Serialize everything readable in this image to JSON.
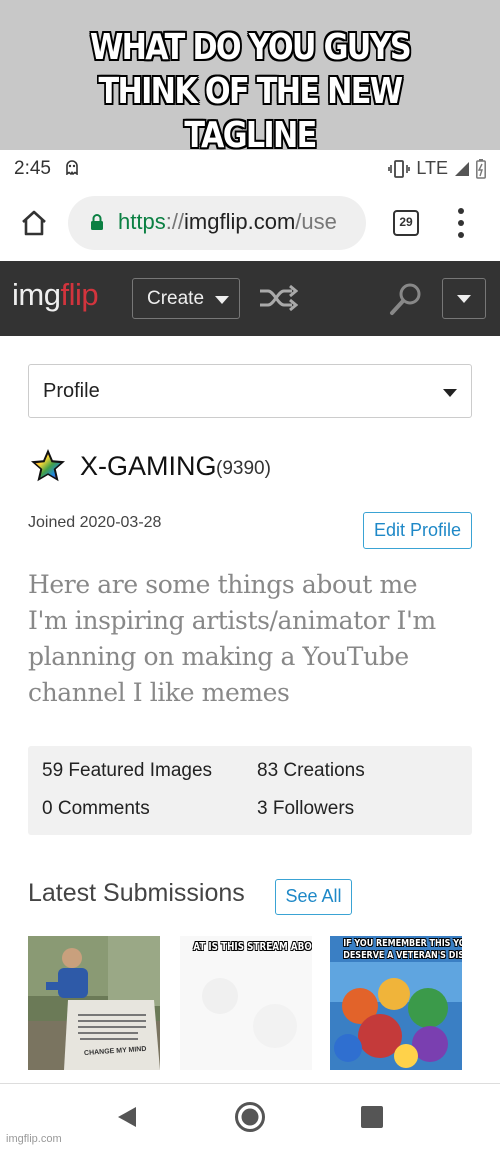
{
  "meme": {
    "caption_line1": "WHAT DO YOU GUYS",
    "caption_line2": "THINK OF THE NEW TAGLINE"
  },
  "status_bar": {
    "time": "2:45",
    "network": "LTE",
    "icons": [
      "ghost-notification-icon",
      "vibrate-icon",
      "signal-icon",
      "battery-icon"
    ]
  },
  "browser": {
    "url_scheme": "https",
    "url_separator": "://",
    "url_host": "imgflip.com",
    "url_path": "/use",
    "tab_count": "29",
    "icons": [
      "home-icon",
      "lock-icon",
      "more-vert-icon"
    ]
  },
  "nav": {
    "logo_img": "img",
    "logo_flip": "flip",
    "create_label": "Create",
    "icons": [
      "shuffle-icon",
      "search-icon",
      "chevron-down-icon"
    ]
  },
  "profile": {
    "select_label": "Profile",
    "username": "X-GAMING",
    "points": "(9390)",
    "joined": "Joined 2020-03-28",
    "edit_label": "Edit Profile",
    "bio_lines": [
      "Here are some things about me",
      "I'm inspiring artists/animator I'm",
      "planning on making a YouTube",
      "channel I like memes"
    ]
  },
  "stats": {
    "featured": "59 Featured Images",
    "creations": "83 Creations",
    "comments": "0 Comments",
    "followers": "3 Followers"
  },
  "latest": {
    "title": "Latest Submissions",
    "see_all_label": "See All",
    "thumbs": [
      {
        "caption": "",
        "sign_text": "CHANGE MY MIND"
      },
      {
        "caption": "AT IS THIS STREAM ABO"
      },
      {
        "caption_line1": "IF YOU REMEMBER THIS YOU",
        "caption_line2": "DESERVE A VETERAN'S DISCOUNT"
      }
    ]
  },
  "watermark": "imgflip.com",
  "colors": {
    "nav_bg": "#333333",
    "logo_flip": "#d2343d",
    "link_blue": "#1e88c7",
    "url_green": "#0b8043",
    "meme_bg": "#c8c8c8"
  }
}
